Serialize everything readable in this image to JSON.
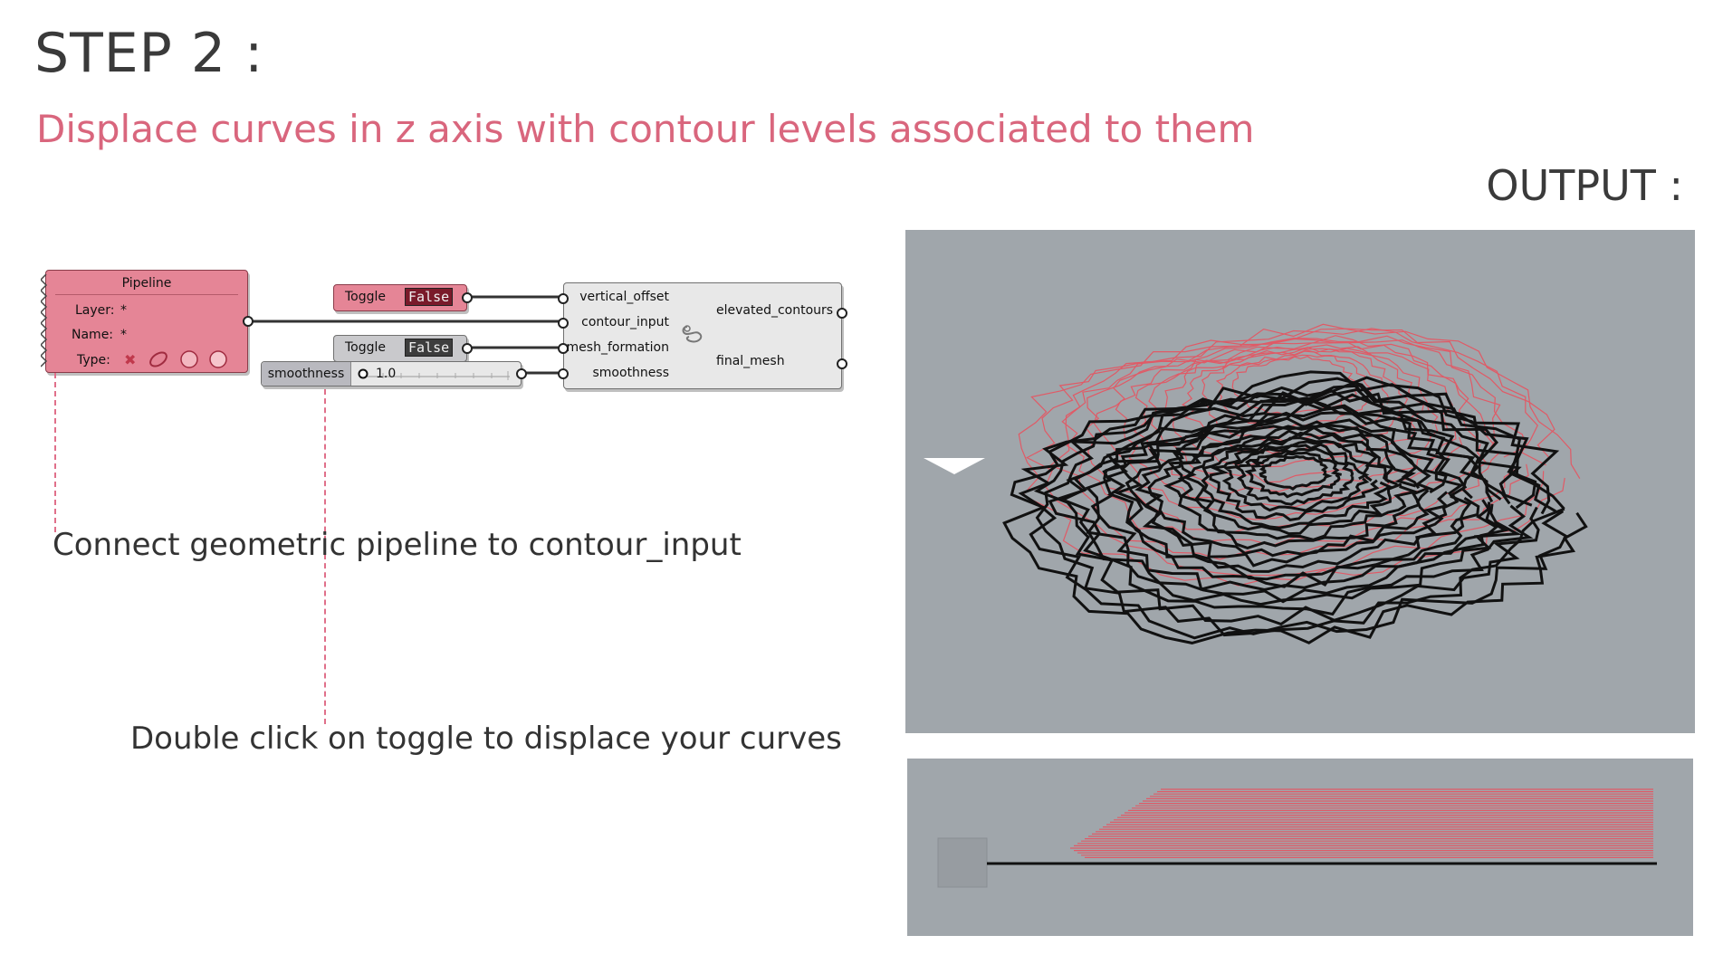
{
  "step_title": "STEP 2 :",
  "subtitle": "Displace curves in z axis with contour levels associated to them",
  "output_label": "OUTPUT :",
  "captions": {
    "connect": "Connect geometric pipeline to contour_input",
    "toggle": "Double click on toggle to displace your curves"
  },
  "pipeline": {
    "title": "Pipeline",
    "layer_label": "Layer:",
    "layer_value": "*",
    "name_label": "Name:",
    "name_value": "*",
    "type_label": "Type:"
  },
  "toggle_1": {
    "label": "Toggle",
    "value": "False"
  },
  "toggle_2": {
    "label": "Toggle",
    "value": "False"
  },
  "slider": {
    "label": "smoothness",
    "value": "1.0"
  },
  "script_component": {
    "inputs": [
      "vertical_offset",
      "contour_input",
      "mesh_formation",
      "smoothness"
    ],
    "outputs": [
      "elevated_contours",
      "final_mesh"
    ]
  },
  "colors": {
    "accent_pink": "#d9667d",
    "component_pink": "#e58596",
    "viewport_bg": "#a0a6ab",
    "contour_red": "#e05a66",
    "contour_black": "#111111"
  }
}
